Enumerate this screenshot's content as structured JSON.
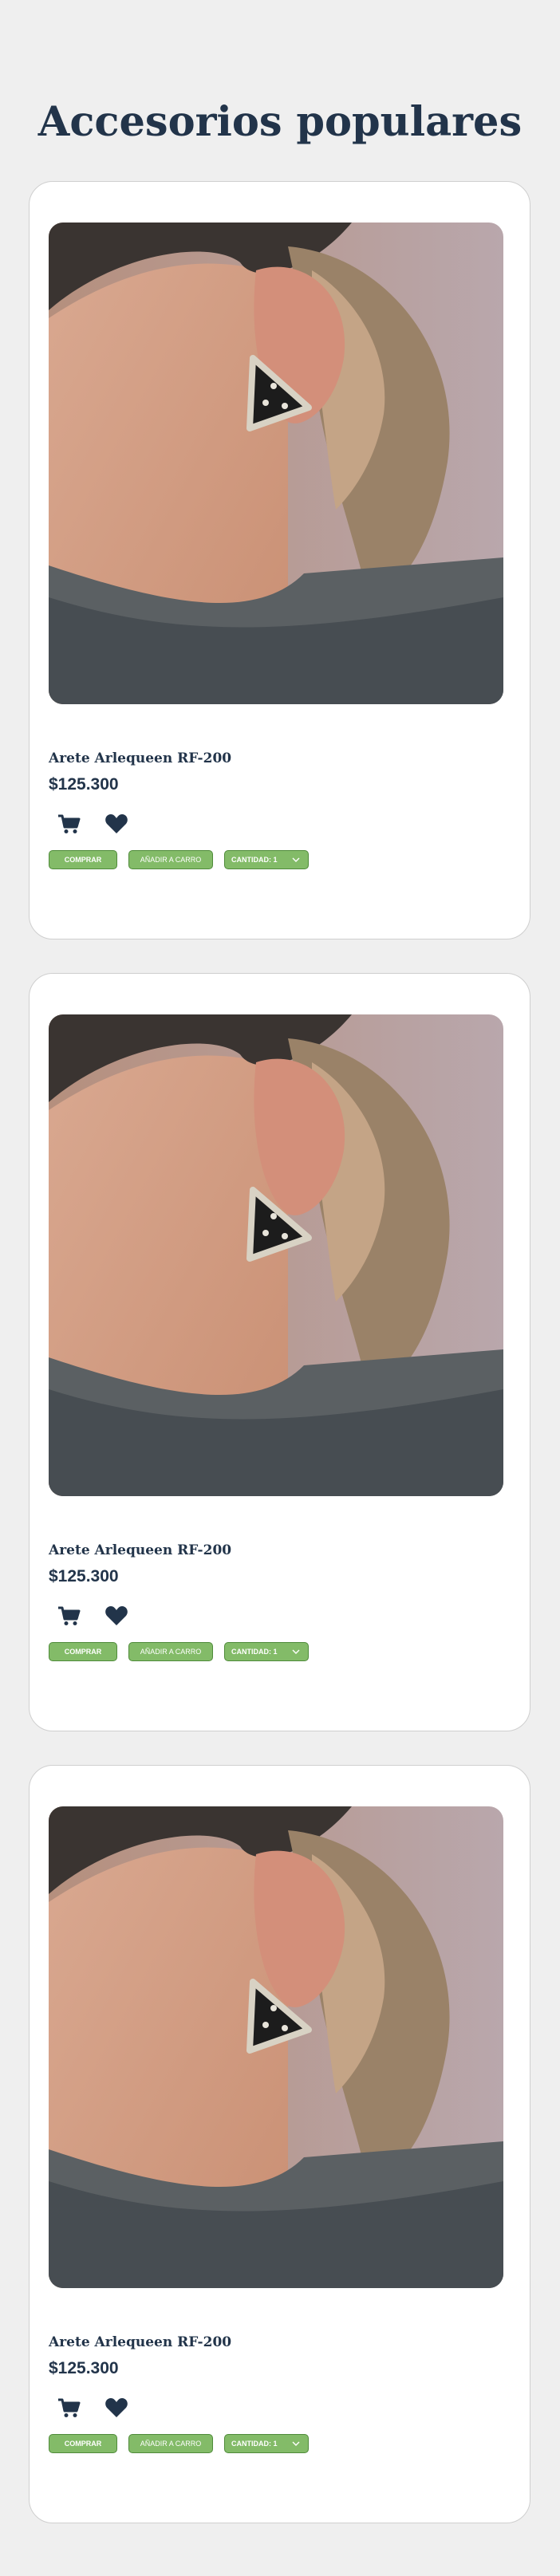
{
  "section": {
    "title": "Accesorios populares"
  },
  "colors": {
    "background": "#efefef",
    "text": "#22344a",
    "button": "#83bb68",
    "button_border": "#4f8b3a"
  },
  "icons": {
    "cart": "shopping-cart-icon",
    "heart": "heart-icon",
    "chevron": "chevron-down-icon"
  },
  "products": [
    {
      "name": "Arete Arlequeen RF-200",
      "price": "$125.300",
      "buy_label": "COMPRAR",
      "add_label": "AÑADIR A CARRO",
      "qty_label": "CANTIDAD: 1"
    },
    {
      "name": "Arete Arlequeen RF-200",
      "price": "$125.300",
      "buy_label": "COMPRAR",
      "add_label": "AÑADIR A CARRO",
      "qty_label": "CANTIDAD: 1"
    },
    {
      "name": "Arete Arlequeen RF-200",
      "price": "$125.300",
      "buy_label": "COMPRAR",
      "add_label": "AÑADIR A CARRO",
      "qty_label": "CANTIDAD: 1"
    }
  ]
}
